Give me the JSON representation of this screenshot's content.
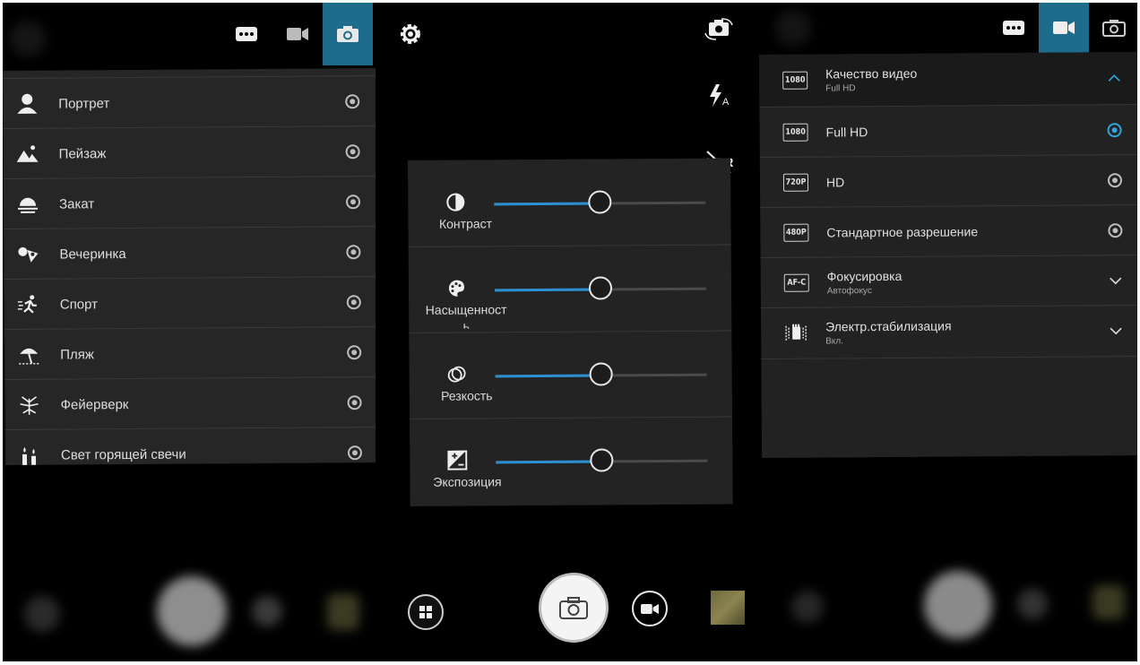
{
  "left": {
    "topbar": {
      "modes": [
        "more-icon",
        "video-icon",
        "camera-icon"
      ],
      "active": "camera"
    },
    "scenes": [
      {
        "label": "Портрет",
        "icon": "portrait-icon"
      },
      {
        "label": "Пейзаж",
        "icon": "landscape-icon"
      },
      {
        "label": "Закат",
        "icon": "sunset-icon"
      },
      {
        "label": "Вечеринка",
        "icon": "party-icon"
      },
      {
        "label": "Спорт",
        "icon": "sport-icon"
      },
      {
        "label": "Пляж",
        "icon": "beach-icon"
      },
      {
        "label": "Фейерверк",
        "icon": "fireworks-icon"
      },
      {
        "label": "Свет горящей свечи",
        "icon": "candle-icon"
      }
    ]
  },
  "middle": {
    "side_icons": [
      "settings-icon",
      "switch-camera-icon",
      "flash-auto-icon",
      "hdr-off-icon",
      "camera-mode-icon"
    ],
    "adjustments": [
      {
        "label": "Контраст",
        "icon": "contrast-icon",
        "value": 0.5
      },
      {
        "label": "Насыщенность",
        "icon": "saturation-icon",
        "value": 0.5
      },
      {
        "label": "Резкость",
        "icon": "sharpness-icon",
        "value": 0.5
      },
      {
        "label": "Экспозиция",
        "icon": "exposure-icon",
        "value": 0.5
      }
    ],
    "bottom": [
      "mode-grid-button",
      "shutter-button",
      "video-record-button",
      "gallery-thumbnail"
    ]
  },
  "right": {
    "topbar": {
      "modes": [
        "more-icon",
        "video-icon",
        "camera-icon"
      ],
      "active": "video"
    },
    "header": {
      "badge": "1080",
      "title": "Качество видео",
      "subtitle": "Full HD"
    },
    "options": [
      {
        "badge": "1080",
        "label": "Full HD",
        "selected": true
      },
      {
        "badge": "720P",
        "label": "HD",
        "selected": false
      },
      {
        "badge": "480P",
        "label": "Стандартное разрешение",
        "selected": false
      }
    ],
    "focus": {
      "badge": "AF-C",
      "title": "Фокусировка",
      "subtitle": "Автофокус"
    },
    "stabilization": {
      "title": "Электр.стабилизация",
      "subtitle": "Вкл."
    }
  },
  "colors": {
    "accent": "#1d6c8c",
    "slider": "#2d8fd0",
    "radio_selected": "#2fa6e0"
  }
}
